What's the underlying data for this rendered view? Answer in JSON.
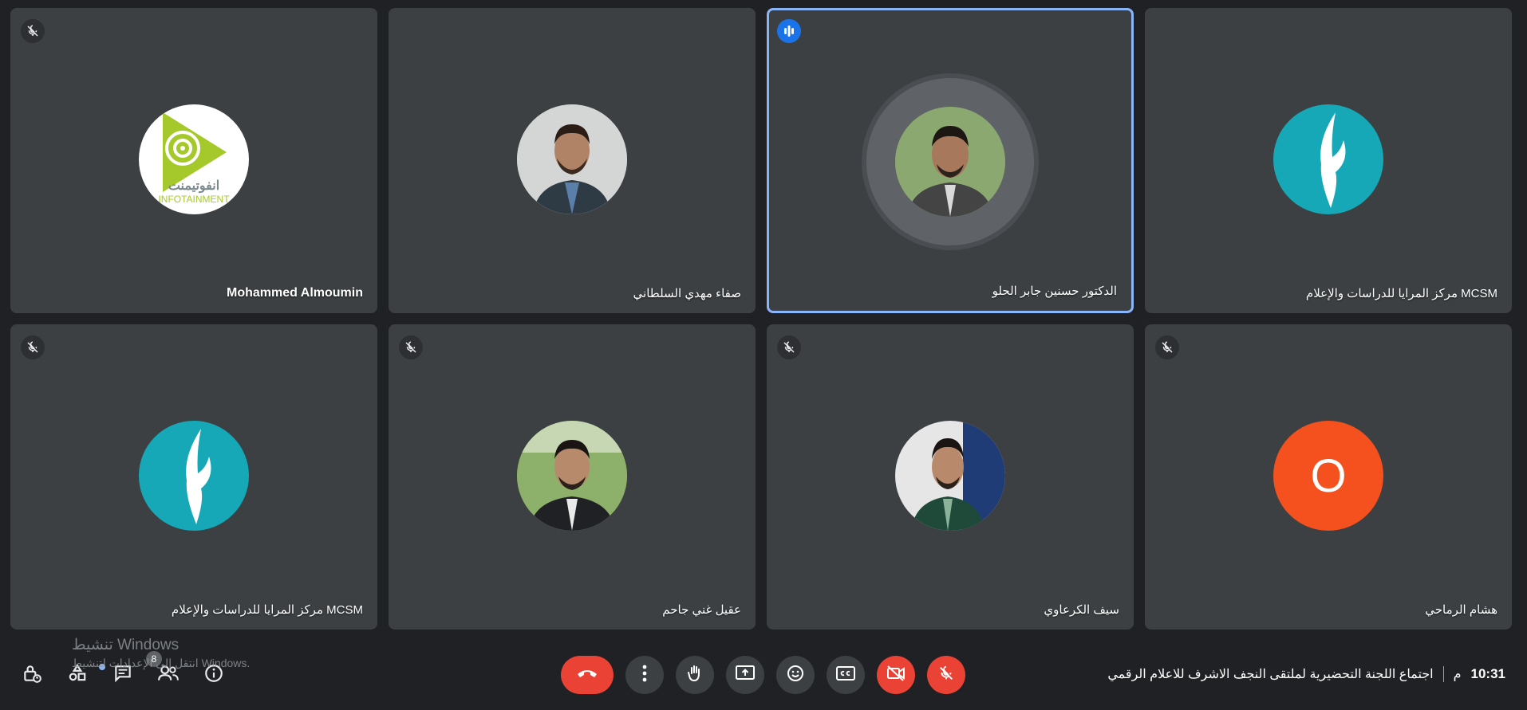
{
  "participants": [
    {
      "name": "Mohammed Almoumin",
      "muted": true,
      "avatar_icon": "infotainment-logo-icon",
      "logo_arabic": "انفوتيمنت",
      "logo_latin": "INFOTAINMENT"
    },
    {
      "name": "صفاء مهدي السلطاني",
      "muted": false,
      "avatar_icon": "profile-photo"
    },
    {
      "name": "الدكتور حسنين جابر الحلو",
      "muted": false,
      "speaking": true,
      "avatar_icon": "profile-photo"
    },
    {
      "name": "مركز المرايا للدراسات والإعلام MCSM",
      "muted": false,
      "avatar_icon": "mcsm-logo-icon"
    },
    {
      "name": "مركز المرايا للدراسات والإعلام MCSM",
      "muted": true,
      "avatar_icon": "mcsm-logo-icon"
    },
    {
      "name": "عقيل غني جاحم",
      "muted": true,
      "avatar_icon": "profile-photo"
    },
    {
      "name": "سيف الكرعاوي",
      "muted": true,
      "avatar_icon": "profile-photo"
    },
    {
      "name": "هشام الرماحي",
      "muted": true,
      "avatar_letter": "O",
      "avatar_color": "#f4511e"
    }
  ],
  "bottom_bar": {
    "left_icons": [
      "lock-person-icon",
      "shapes-icon",
      "chat-icon",
      "people-icon",
      "info-icon"
    ],
    "people_count": "8",
    "watermark_line1": "تنشيط Windows",
    "watermark_line2": "انتقل إلى الإعدادات لتنشيط Windows.",
    "controls": [
      "hangup-icon",
      "more-options-icon",
      "raise-hand-icon",
      "present-icon",
      "emoji-icon",
      "captions-icon",
      "camera-off-icon",
      "mic-off-icon"
    ],
    "meeting_title": "اجتماع اللجنة التحضيرية لملتقى النجف الاشرف للاعلام الرقمي",
    "time": "10:31",
    "time_suffix": "م"
  },
  "colors": {
    "background": "#202124",
    "tile": "#3c4043",
    "speaking_border": "#8ab4f8",
    "red": "#ea4335",
    "accent_blue": "#1a73e8"
  }
}
